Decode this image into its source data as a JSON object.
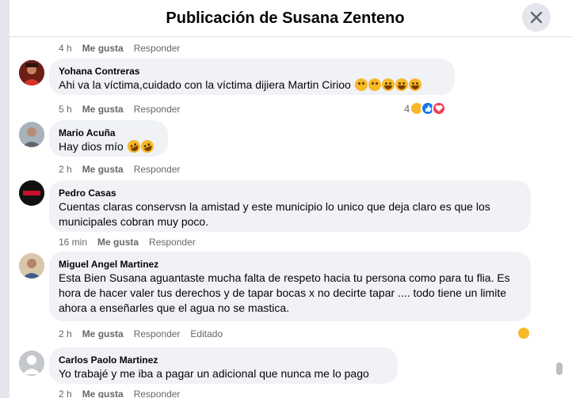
{
  "header": {
    "title": "Publicación de Susana Zenteno"
  },
  "top_meta": {
    "time": "4 h",
    "like": "Me gusta",
    "reply": "Responder"
  },
  "comments": [
    {
      "author": "Yohana Contreras",
      "text": "Ahi va la víctima,cuidado con la víctima dijiera Martin Cirioo",
      "time": "5 h",
      "like": "Me gusta",
      "reply": "Responder",
      "reaction_count": "4",
      "reaction_icons": [
        "haha-icon",
        "like-icon",
        "love-icon"
      ]
    },
    {
      "author": "Mario Acuña",
      "text": "Hay dios mío",
      "time": "2 h",
      "like": "Me gusta",
      "reply": "Responder"
    },
    {
      "author": "Pedro Casas",
      "text": "Cuentas claras conservsn la amistad y este municipio lo unico que deja claro es que los municipales cobran muy poco.",
      "time": "16 min",
      "like": "Me gusta",
      "reply": "Responder",
      "avatar_text": "APAGÓN"
    },
    {
      "author": "Miguel Angel Martinez",
      "text": "Esta Bien Susana aguantaste mucha falta de respeto hacia tu persona como para tu flia. Es hora de hacer valer tus derechos y de tapar bocas x no decirte tapar .... todo tiene un limite ahora a enseñarles que el agua no se mastica.",
      "time": "2 h",
      "like": "Me gusta",
      "reply": "Responder",
      "edited": "Editado",
      "reaction_icons": [
        "haha-icon"
      ]
    },
    {
      "author": "Carlos Paolo Martinez",
      "text": "Yo trabajé y me iba a pagar un adicional que nunca me lo pago",
      "time": "2 h",
      "like": "Me gusta",
      "reply": "Responder"
    }
  ]
}
